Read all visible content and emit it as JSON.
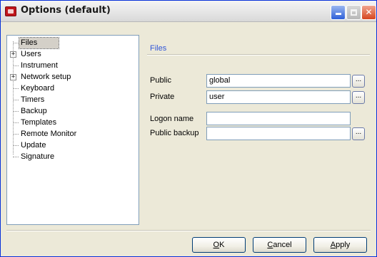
{
  "window": {
    "title": "Options (default)"
  },
  "tree": {
    "items": [
      {
        "label": "Files",
        "selected": true,
        "expandable": false
      },
      {
        "label": "Users",
        "selected": false,
        "expandable": true
      },
      {
        "label": "Instrument",
        "selected": false,
        "expandable": false
      },
      {
        "label": "Network setup",
        "selected": false,
        "expandable": true
      },
      {
        "label": "Keyboard",
        "selected": false,
        "expandable": false
      },
      {
        "label": "Timers",
        "selected": false,
        "expandable": false
      },
      {
        "label": "Backup",
        "selected": false,
        "expandable": false
      },
      {
        "label": "Templates",
        "selected": false,
        "expandable": false
      },
      {
        "label": "Remote Monitor",
        "selected": false,
        "expandable": false
      },
      {
        "label": "Update",
        "selected": false,
        "expandable": false
      },
      {
        "label": "Signature",
        "selected": false,
        "expandable": false
      }
    ]
  },
  "panel": {
    "title": "Files",
    "fields": [
      {
        "label": "Public",
        "value": "global",
        "has_browse": true
      },
      {
        "label": "Private",
        "value": "user",
        "has_browse": true
      },
      {
        "label": "Logon name",
        "value": "",
        "has_browse": false
      },
      {
        "label": "Public backup",
        "value": "",
        "has_browse": true
      }
    ],
    "browse_label": "..."
  },
  "buttons": {
    "ok_mnemonic": "O",
    "ok_rest": "K",
    "cancel_mnemonic": "C",
    "cancel_rest": "ancel",
    "apply_mnemonic": "A",
    "apply_rest": "pply"
  },
  "colors": {
    "accent": "#2f55d8",
    "window_bg": "#ece9d8",
    "border": "#7f9db9"
  }
}
